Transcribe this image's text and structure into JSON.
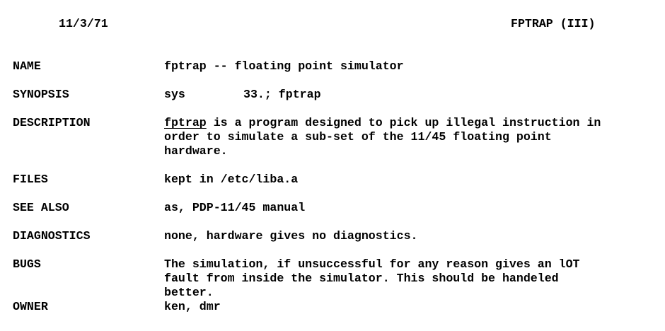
{
  "header": {
    "date": "11/3/71",
    "page_id": "FPTRAP (III)"
  },
  "sections": {
    "name": {
      "label": "NAME",
      "text": "fptrap -- floating point simulator"
    },
    "synopsis": {
      "label": "SYNOPSIS",
      "cmd": "sys",
      "args": "33.; fptrap"
    },
    "description": {
      "label": "DESCRIPTION",
      "term": "fptrap",
      "line1_rest": " is a program designed to pick up illegal instruction in",
      "line2": "order to simulate a sub-set of the 11/45 floating point",
      "line3": "hardware."
    },
    "files": {
      "label": "FILES",
      "text": "kept in /etc/liba.a"
    },
    "see_also": {
      "label": "SEE ALSO",
      "text": "as, PDP-11/45 manual"
    },
    "diagnostics": {
      "label": "DIAGNOSTICS",
      "text": "none, hardware gives no diagnostics."
    },
    "bugs": {
      "label": "BUGS",
      "line1": "The simulation, if unsuccessful for any reason gives an lOT",
      "line2": "fault from inside the simulator. This should be handeled",
      "line3": "better."
    },
    "owner": {
      "label": "OWNER",
      "text": "ken, dmr"
    }
  }
}
